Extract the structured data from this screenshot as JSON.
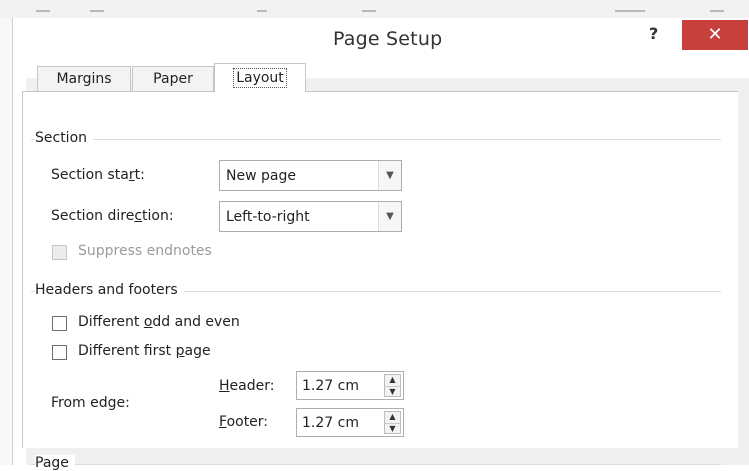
{
  "dialog": {
    "title": "Page Setup",
    "help_label": "?",
    "close_label": "✕"
  },
  "tabs": [
    {
      "label": "Margins",
      "active": false
    },
    {
      "label": "Paper",
      "active": false
    },
    {
      "label": "Layout",
      "active": true
    }
  ],
  "section": {
    "heading": "Section",
    "start_label_pre": "Section sta",
    "start_label_key": "r",
    "start_label_post": "t:",
    "start_value": "New page",
    "direction_label_pre": "Section dire",
    "direction_label_key": "c",
    "direction_label_post": "tion:",
    "direction_value": "Left-to-right",
    "suppress_endnotes_label": "Suppress endnotes",
    "suppress_endnotes_checked": false,
    "suppress_endnotes_disabled": true
  },
  "headers_footers": {
    "heading": "Headers and footers",
    "odd_even_pre": "Different ",
    "odd_even_key": "o",
    "odd_even_post": "dd and even",
    "odd_even_checked": false,
    "first_page_pre": "Different first ",
    "first_page_key": "p",
    "first_page_post": "age",
    "first_page_checked": false,
    "from_edge_label": "From edge:",
    "header_key": "H",
    "header_post": "eader:",
    "header_value": "1.27 cm",
    "footer_key": "F",
    "footer_post": "ooter:",
    "footer_value": "1.27 cm"
  },
  "page": {
    "heading": "Page"
  },
  "icons": {
    "dropdown": "chevron-down-icon",
    "spin_up": "spin-up-icon",
    "spin_down": "spin-down-icon"
  }
}
